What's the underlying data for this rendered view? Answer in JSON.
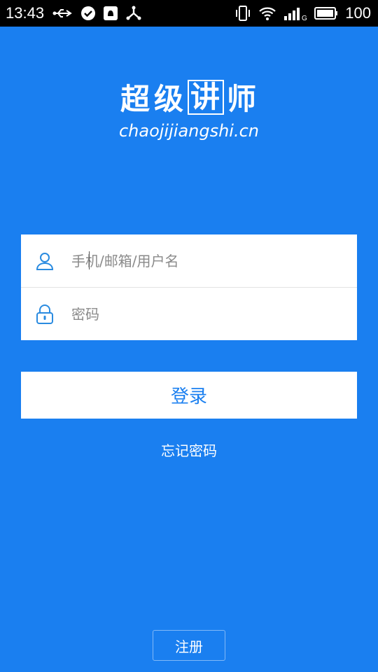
{
  "status_bar": {
    "time": "13:43",
    "battery_text": "100",
    "left_icons": [
      "usb-icon",
      "check-circle-icon",
      "notification-icon",
      "share-icon"
    ],
    "right_icons": [
      "vibrate-icon",
      "wifi-icon",
      "signal-icon",
      "battery-icon"
    ]
  },
  "logo": {
    "chars": [
      "超",
      "级",
      "讲",
      "师"
    ],
    "domain": "chaojijiangshi.cn"
  },
  "form": {
    "username_placeholder": "手机/邮箱/用户名",
    "username_icon": "user-icon",
    "password_placeholder": "密码",
    "password_icon": "lock-icon"
  },
  "login_label": "登录",
  "forgot_label": "忘记密码",
  "register_label": "注册",
  "colors": {
    "accent": "#1a7ff0",
    "icon_blue": "#2a8be0"
  }
}
